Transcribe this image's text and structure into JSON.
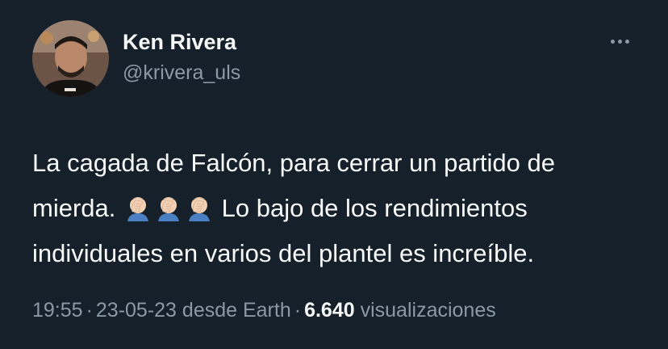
{
  "author": {
    "display_name": "Ken Rivera",
    "handle": "@krivera_uls"
  },
  "more_icon": "more-horizontal-icon",
  "tweet": {
    "line1": "La cagada de Falcón, para cerrar un partido de",
    "line2_before": "mierda.",
    "line2_after": "Lo bajo de los rendimientos",
    "line3": "individuales en varios del plantel es increíble.",
    "emojis": [
      "facepalm-emoji",
      "facepalm-emoji",
      "facepalm-emoji"
    ]
  },
  "meta": {
    "time": "19:55",
    "date": "23-05-23",
    "source": "desde Earth",
    "views_count": "6.640",
    "views_label": "visualizaciones",
    "separator": "·"
  },
  "colors": {
    "background": "#15202b",
    "text_primary": "#f7f9f9",
    "text_secondary": "#8b98a5"
  }
}
